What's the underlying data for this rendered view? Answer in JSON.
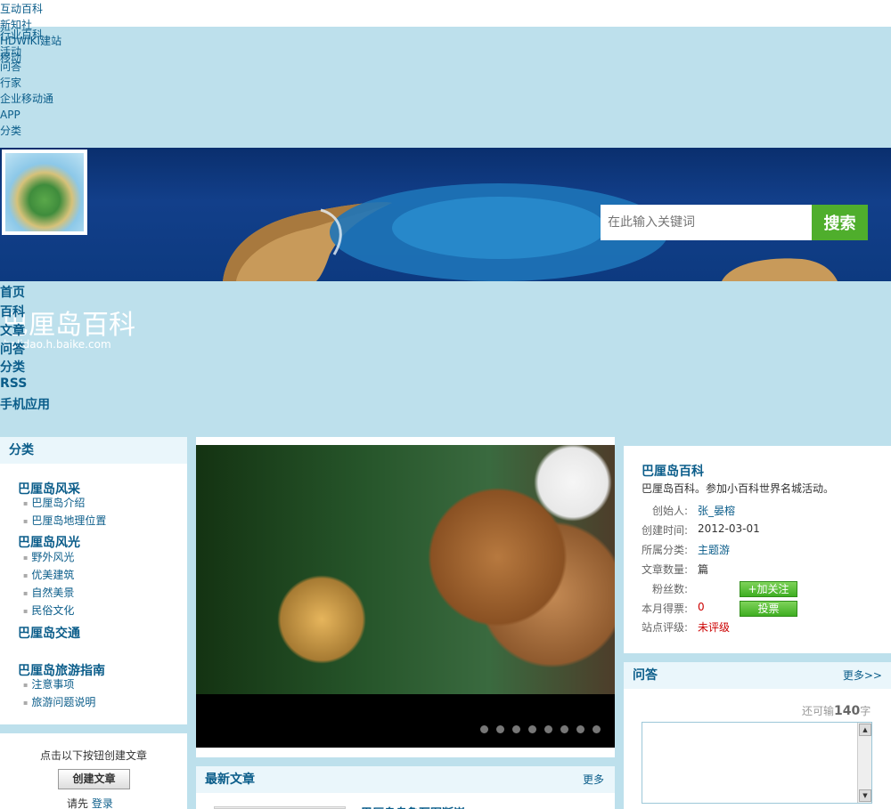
{
  "top_nav": [
    "互动百科",
    "新知社",
    "行业百科",
    "HDWIKI建站",
    "活动",
    "移动",
    "问答",
    "行家",
    "企业移动通",
    "APP",
    "分类"
  ],
  "search": {
    "placeholder": "在此输入关键词",
    "button": "搜索"
  },
  "site": {
    "title": "巴厘岛百科",
    "domain": "balidao.h.baike.com"
  },
  "main_nav": [
    "首页",
    "百科",
    "文章",
    "问答",
    "分类",
    "RSS",
    "手机应用"
  ],
  "categories": {
    "title": "分类",
    "groups": [
      {
        "name": "巴厘岛风采",
        "items": [
          "巴厘岛介绍",
          "巴厘岛地理位置"
        ]
      },
      {
        "name": "巴厘岛风光",
        "items": [
          "野外风光",
          "优美建筑",
          "自然美景",
          "民俗文化"
        ]
      },
      {
        "name": "巴厘岛交通",
        "items": []
      },
      {
        "name": "巴厘岛旅游指南",
        "items": [
          "注意事项",
          "旅游问题说明"
        ]
      }
    ]
  },
  "create": {
    "prompt": "点击以下按钮创建文章",
    "button": "创建文章",
    "login_prefix": "请先",
    "login_link": "登录"
  },
  "slider": {
    "dot_count": 8
  },
  "info": {
    "title": "巴厘岛百科",
    "desc": "巴厘岛百科。参加小百科世界名城活动。",
    "creator_label": "创始人:",
    "creator": "张_晏榕",
    "created_label": "创建时间:",
    "created": "2012-03-01",
    "category_label": "所属分类:",
    "category": "主题游",
    "articles_label": "文章数量:",
    "articles": "篇",
    "fans_label": "粉丝数:",
    "fans": "",
    "votes_label": "本月得票:",
    "votes": "0",
    "rating_label": "站点评级:",
    "rating": "未评级",
    "follow_button": "+加关注",
    "vote_button": "投票"
  },
  "qa": {
    "title": "问答",
    "more": "更多>>",
    "remain_prefix": "还可输",
    "remain_count": "140",
    "remain_suffix": "字"
  },
  "news": {
    "title": "最新文章",
    "more": "更多",
    "first_title": "巴厘岛乌鲁瓦图断崖"
  },
  "colors": {
    "link": "#0b5d8a",
    "page_bg": "#bde0ec",
    "green_button": "#4fae2c",
    "red_value": "#cc0000"
  }
}
